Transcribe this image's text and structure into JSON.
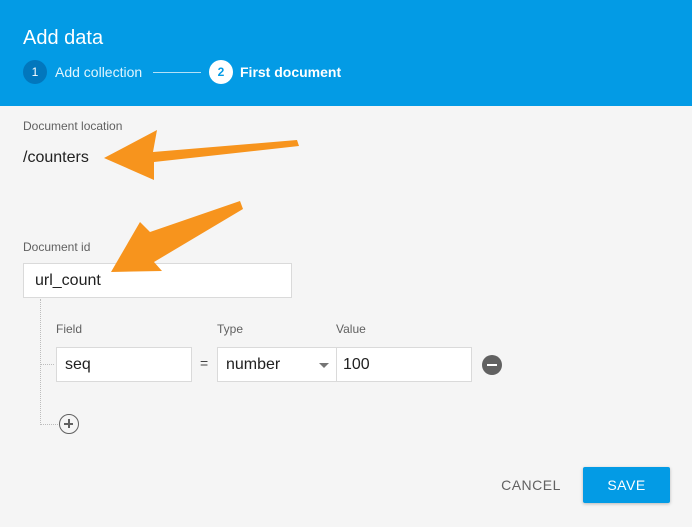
{
  "dialog": {
    "title": "Add data"
  },
  "stepper": {
    "steps": [
      {
        "number": "1",
        "label": "Add collection",
        "state": "done"
      },
      {
        "number": "2",
        "label": "First document",
        "state": "active"
      }
    ]
  },
  "location": {
    "label": "Document location",
    "value": "/counters"
  },
  "document_id": {
    "label": "Document id",
    "value": "url_count"
  },
  "fields": {
    "headers": {
      "field": "Field",
      "type": "Type",
      "value": "Value"
    },
    "rows": [
      {
        "field": "seq",
        "equals": "=",
        "type": "number",
        "value": "100"
      }
    ],
    "remove_icon": "remove-circle-icon",
    "add_icon": "add-circle-icon"
  },
  "actions": {
    "cancel": "CANCEL",
    "save": "SAVE"
  },
  "colors": {
    "header": "#039be5",
    "annotation_arrow": "#f7941d",
    "save_button": "#039be5"
  }
}
